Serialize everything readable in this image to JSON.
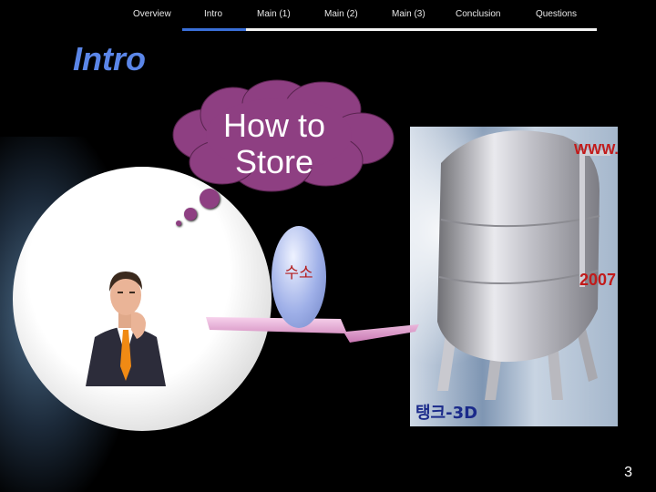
{
  "nav": {
    "items": [
      {
        "label": "Overview"
      },
      {
        "label": "Intro"
      },
      {
        "label": "Main (1)"
      },
      {
        "label": "Main (2)"
      },
      {
        "label": "Main (3)"
      },
      {
        "label": "Conclusion"
      },
      {
        "label": "Questions"
      }
    ],
    "active_index": 1,
    "colors": {
      "active_underline": "#3a6fd8",
      "underline": "#f2f2f2"
    }
  },
  "slide": {
    "title": "Intro",
    "thought_cloud": {
      "line1": "How to",
      "line2": "Store",
      "color": "#8e3f82"
    },
    "egg_label": "수소",
    "tank_photo": {
      "watermark_top": "WWW.",
      "watermark_year": "2007",
      "caption": "탱크-3D"
    },
    "page_number": "3"
  },
  "colors": {
    "background": "#000000",
    "title": "#5b86e8",
    "ribbon": "#e8a6d4"
  }
}
